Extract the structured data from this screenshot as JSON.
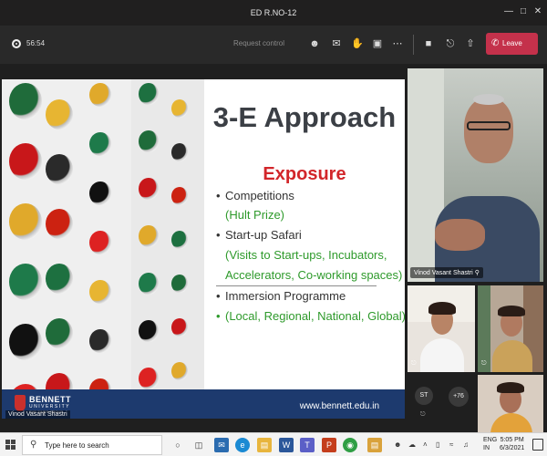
{
  "window": {
    "title": "ED R.NO-12"
  },
  "toolbar": {
    "timer": "56:54",
    "request_control": "Request control",
    "leave_label": "Leave"
  },
  "slide": {
    "title": "3-E Approach",
    "subtitle": "Exposure",
    "bullets": [
      {
        "text": "Competitions",
        "style": "bullet"
      },
      {
        "text": "(Hult Prize)",
        "style": "green"
      },
      {
        "text": "Start-up Safari",
        "style": "bullet"
      },
      {
        "text": "(Visits to Start-ups, Incubators,",
        "style": "green"
      },
      {
        "text": "Accelerators, Co-working spaces)",
        "style": "green"
      },
      {
        "text": "Immersion Programme",
        "style": "bullet"
      },
      {
        "text": "(Local, Regional, National, Global)",
        "style": "green"
      }
    ],
    "logo_name": "BENNETT",
    "logo_line2": "UNIVERSITY",
    "logo_line3": "THE TIMES GROUP",
    "url": "www.bennett.edu.in",
    "presenter_tag": "Vinod Vasant Shastri"
  },
  "participants": {
    "main_name": "Vinod Vasant Shastri",
    "avatar_initials": "ST",
    "overflow_count": "+76"
  },
  "taskbar": {
    "search_placeholder": "Type here to search",
    "lang_line1": "ENG",
    "lang_line2": "IN",
    "time": "5:05 PM",
    "date": "6/3/2021"
  },
  "colors": {
    "leave_red": "#c4314b",
    "slide_title": "#3b3f45",
    "exposure_red": "#d2262a",
    "green_text": "#2e9a2b",
    "footer_blue": "#1d3a6e"
  }
}
